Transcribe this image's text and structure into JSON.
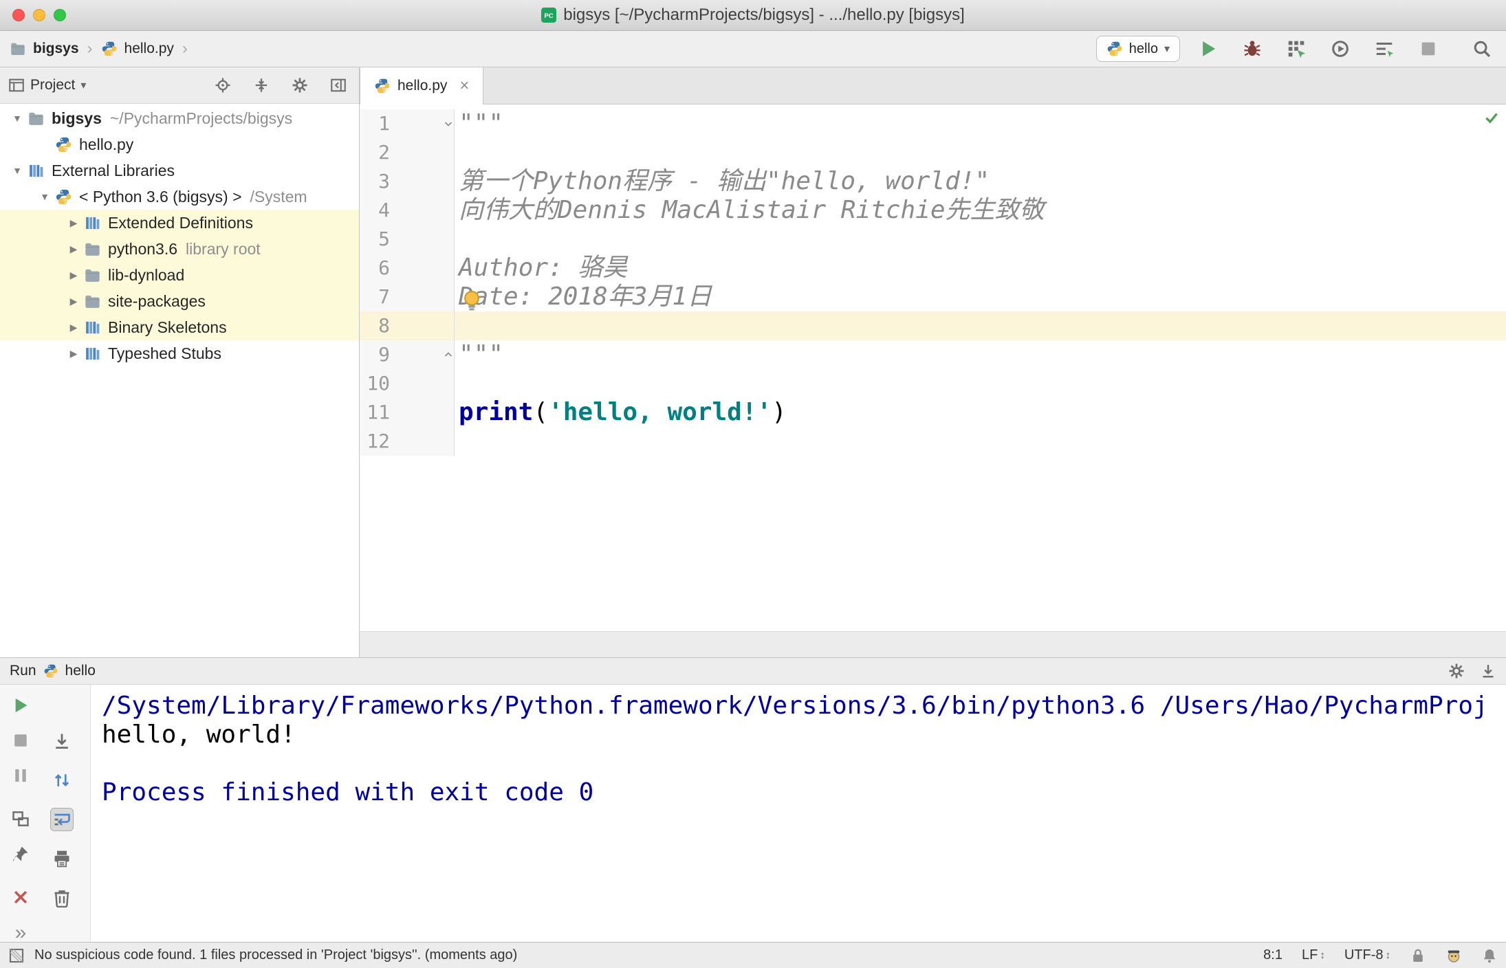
{
  "icons": {
    "breadcrumb_separator": "›",
    "combo_caret": "▾",
    "tab_close": "×",
    "more": "»",
    "updown": "↕",
    "tree_expanded": "▼",
    "tree_collapsed": "▶"
  },
  "window": {
    "title": "bigsys [~/PycharmProjects/bigsys] - .../hello.py [bigsys]"
  },
  "toolbar": {
    "breadcrumb": [
      {
        "label": "bigsys"
      },
      {
        "label": "hello.py"
      }
    ],
    "run_config_label": "hello"
  },
  "project_panel": {
    "title": "Project",
    "tree": [
      {
        "label": "bigsys",
        "suffix": "~/PycharmProjects/bigsys",
        "icon": "folder",
        "arrow": "down",
        "level": 0,
        "bold": true
      },
      {
        "label": "hello.py",
        "icon": "python",
        "level": 1
      },
      {
        "label": "External Libraries",
        "icon": "library",
        "arrow": "down",
        "level": 0
      },
      {
        "label": "< Python 3.6 (bigsys) >",
        "suffix": "/System",
        "icon": "python",
        "arrow": "down",
        "level": 1
      },
      {
        "label": "Extended Definitions",
        "icon": "library",
        "arrow": "right",
        "level": 2,
        "highlight": true
      },
      {
        "label": "python3.6",
        "suffix": "library root",
        "icon": "folder",
        "arrow": "right",
        "level": 2,
        "highlight": true
      },
      {
        "label": "lib-dynload",
        "icon": "folder",
        "arrow": "right",
        "level": 2,
        "highlight": true
      },
      {
        "label": "site-packages",
        "icon": "folder",
        "arrow": "right",
        "level": 2,
        "highlight": true
      },
      {
        "label": "Binary Skeletons",
        "icon": "library",
        "arrow": "right",
        "level": 2,
        "highlight": true
      },
      {
        "label": "Typeshed Stubs",
        "icon": "library",
        "arrow": "right",
        "level": 2
      }
    ]
  },
  "editor": {
    "tab_label": "hello.py",
    "lines": [
      {
        "n": 1,
        "fold": "start",
        "segments": [
          {
            "t": "\"\"\"",
            "s": "doc"
          }
        ]
      },
      {
        "n": 2,
        "segments": []
      },
      {
        "n": 3,
        "segments": [
          {
            "t": "第一个Python程序 - 输出\"hello, world!\"",
            "s": "doc"
          }
        ]
      },
      {
        "n": 4,
        "segments": [
          {
            "t": "向伟大的Dennis MacAlistair Ritchie先生致敬",
            "s": "doc"
          }
        ]
      },
      {
        "n": 5,
        "segments": []
      },
      {
        "n": 6,
        "segments": [
          {
            "t": "Author: 骆昊",
            "s": "doc"
          }
        ]
      },
      {
        "n": 7,
        "segments": [
          {
            "t": "Date: 2018年3月1日",
            "s": "doc"
          }
        ]
      },
      {
        "n": 8,
        "caret": true,
        "segments": []
      },
      {
        "n": 9,
        "fold": "end",
        "segments": [
          {
            "t": "\"\"\"",
            "s": "doc"
          }
        ]
      },
      {
        "n": 10,
        "segments": []
      },
      {
        "n": 11,
        "segments": [
          {
            "t": "print",
            "s": "builtin"
          },
          {
            "t": "(",
            "s": "plain"
          },
          {
            "t": "'hello, world!'",
            "s": "string"
          },
          {
            "t": ")",
            "s": "plain"
          }
        ]
      },
      {
        "n": 12,
        "segments": []
      }
    ]
  },
  "run_panel": {
    "title": "Run",
    "config_label": "hello",
    "console": [
      {
        "text": "/System/Library/Frameworks/Python.framework/Versions/3.6/bin/python3.6 /Users/Hao/PycharmProj",
        "style": "command"
      },
      {
        "text": "hello, world!",
        "style": "plain"
      },
      {
        "text": "",
        "style": "plain"
      },
      {
        "text": "Process finished with exit code 0",
        "style": "command"
      }
    ]
  },
  "status_bar": {
    "message": "No suspicious code found. 1 files processed in 'Project 'bigsys''. (moments ago)",
    "caret_position": "8:1",
    "line_separator": "LF",
    "encoding": "UTF-8"
  },
  "colors": {
    "run_green": "#59A869",
    "error_red": "#C75450",
    "string_teal": "#008080",
    "keyword_blue": "#00009C",
    "console_command_blue": "#00009C",
    "caret_line": "#FCF5DA",
    "tree_highlight": "#FCFAD8"
  }
}
